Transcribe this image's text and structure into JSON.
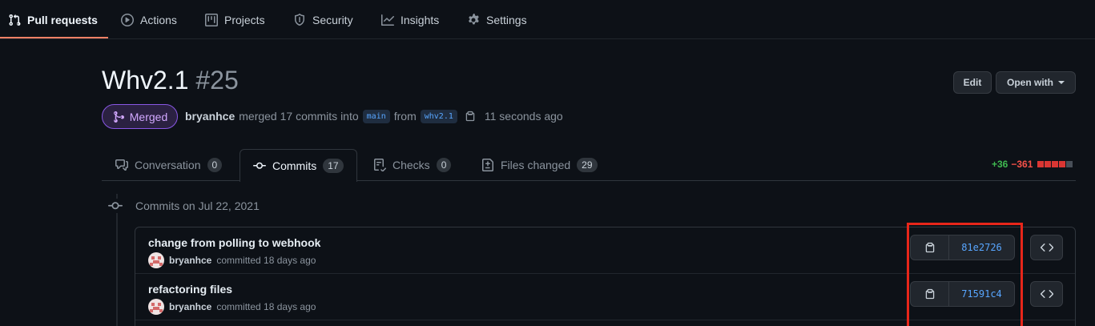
{
  "nav": {
    "items": [
      {
        "label": "Pull requests",
        "icon": "git-pull-request-icon",
        "active": true
      },
      {
        "label": "Actions",
        "icon": "play-icon"
      },
      {
        "label": "Projects",
        "icon": "project-icon"
      },
      {
        "label": "Security",
        "icon": "shield-icon"
      },
      {
        "label": "Insights",
        "icon": "graph-icon"
      },
      {
        "label": "Settings",
        "icon": "gear-icon"
      }
    ]
  },
  "pr": {
    "title": "Whv2.1",
    "number": "#25",
    "state": "Merged",
    "author": "bryanhce",
    "merged_text": "merged 17 commits into",
    "base_branch": "main",
    "from_text": "from",
    "head_branch": "whv2.1",
    "time": "11 seconds ago",
    "edit_label": "Edit",
    "open_with_label": "Open with"
  },
  "tabs": [
    {
      "label": "Conversation",
      "count": "0",
      "icon": "comment-discussion-icon"
    },
    {
      "label": "Commits",
      "count": "17",
      "icon": "git-commit-icon",
      "selected": true
    },
    {
      "label": "Checks",
      "count": "0",
      "icon": "checklist-icon"
    },
    {
      "label": "Files changed",
      "count": "29",
      "icon": "file-diff-icon"
    }
  ],
  "diffstat": {
    "additions": "+36",
    "deletions": "−361"
  },
  "commits": {
    "date_heading": "Commits on Jul 22, 2021",
    "items": [
      {
        "message": "change from polling to webhook",
        "author": "bryanhce",
        "when": "committed 18 days ago",
        "sha": "81e2726"
      },
      {
        "message": "refactoring files",
        "author": "bryanhce",
        "when": "committed 18 days ago",
        "sha": "71591c4"
      }
    ]
  },
  "colors": {
    "accent_underline": "#f78166",
    "merged": "#8957e5",
    "highlight": "#e8261a",
    "sha_link": "#58a6ff"
  }
}
